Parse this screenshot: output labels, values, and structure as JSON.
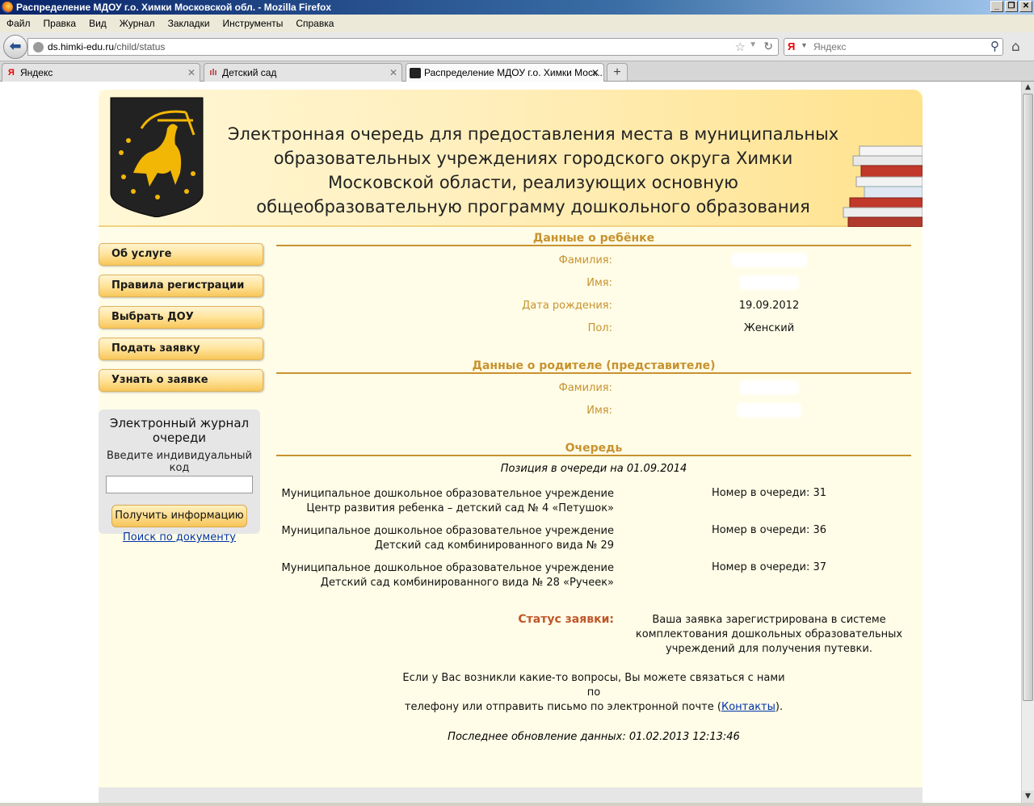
{
  "window": {
    "title": "Распределение МДОУ г.о. Химки Московской обл. - Mozilla Firefox",
    "controls": {
      "minimize": "_",
      "restore": "❐",
      "close": "✕"
    }
  },
  "menu": [
    "Файл",
    "Правка",
    "Вид",
    "Журнал",
    "Закладки",
    "Инструменты",
    "Справка"
  ],
  "nav": {
    "url_domain": "ds.himki-edu.ru",
    "url_path": "/child/status",
    "search_placeholder": "Яндекс",
    "search_engine_letter": "Я"
  },
  "tabs": [
    {
      "label": "Яндекс",
      "icon": "Я",
      "active": false
    },
    {
      "label": "Детский сад",
      "icon": "ılı",
      "active": false
    },
    {
      "label": "Распределение МДОУ г.о. Химки Моск...",
      "icon": "",
      "active": true
    }
  ],
  "header": {
    "title_lines": [
      "Электронная очередь для предоставления места в муниципальных",
      "образовательных учреждениях городского округа Химки",
      "Московской области, реализующих основную",
      "общеобразовательную программу дошкольного образования"
    ]
  },
  "sidebar": {
    "items": [
      "Об услуге",
      "Правила регистрации",
      "Выбрать ДОУ",
      "Подать заявку",
      "Узнать о заявке"
    ],
    "journal": {
      "title": "Электронный журнал очереди",
      "code_label": "Введите индивидуальный код",
      "code_value": "",
      "button": "Получить информацию",
      "doc_search_link": "Поиск по документу"
    }
  },
  "child": {
    "section_title": "Данные о ребёнке",
    "fields": [
      {
        "label": "Фамилия:",
        "value": "",
        "hidden": true
      },
      {
        "label": "Имя:",
        "value": "",
        "hidden": true
      },
      {
        "label": "Дата рождения:",
        "value": "19.09.2012",
        "hidden": false
      },
      {
        "label": "Пол:",
        "value": "Женский",
        "hidden": false
      }
    ]
  },
  "parent": {
    "section_title": "Данные о родителе (представителе)",
    "fields": [
      {
        "label": "Фамилия:",
        "value": "",
        "hidden": true
      },
      {
        "label": "Имя:",
        "value": "",
        "hidden": true
      }
    ]
  },
  "queue": {
    "section_title": "Очередь",
    "position_caption": "Позиция в очереди на 01.09.2014",
    "items": [
      {
        "line1": "Муниципальное дошкольное образовательное учреждение",
        "line2": "Центр развития ребенка – детский сад № 4 «Петушок»",
        "number_label": "Номер в очереди: 31"
      },
      {
        "line1": "Муниципальное дошкольное образовательное учреждение",
        "line2": "Детский сад комбинированного вида № 29",
        "number_label": "Номер в очереди: 36"
      },
      {
        "line1": "Муниципальное дошкольное образовательное учреждение",
        "line2": "Детский сад комбинированного вида № 28 «Ручеек»",
        "number_label": "Номер в очереди: 37"
      }
    ]
  },
  "status": {
    "label": "Статус заявки:",
    "value_lines": [
      "Ваша заявка зарегистрирована в системе",
      "комплектования дошкольных образовательных",
      "учреждений для получения путевки."
    ]
  },
  "help": {
    "line1": "Если у Вас возникли какие-то вопросы, Вы можете связаться с нами по",
    "line2_before": "телефону или отправить письмо по электронной почте (",
    "link": "Контакты",
    "line2_after": ")."
  },
  "updated": "Последнее обновление данных: 01.02.2013 12:13:46",
  "colors": {
    "accent": "#c8922f",
    "status": "#c0562a",
    "page_bg": "#fffde7",
    "link": "#0033aa"
  }
}
